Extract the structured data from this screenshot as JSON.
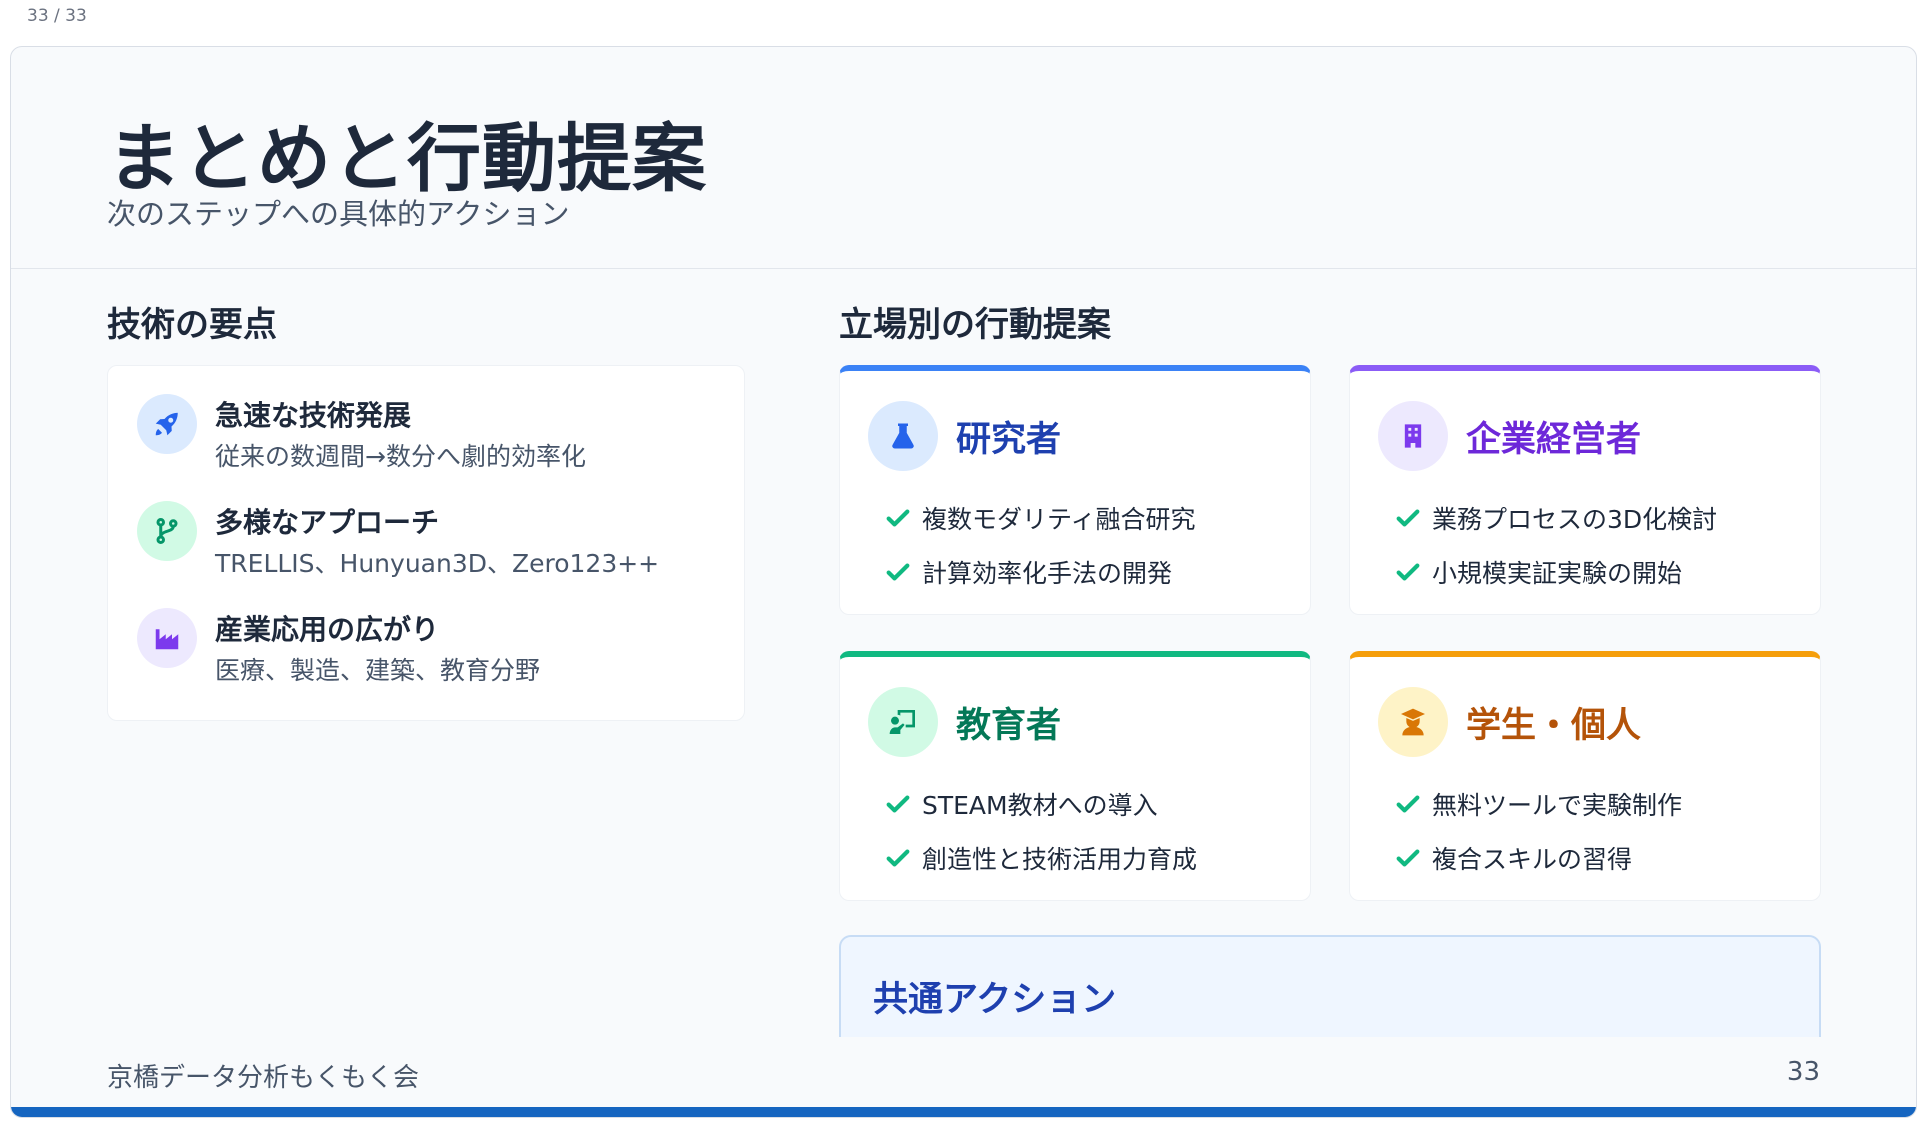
{
  "page_counter": "33 / 33",
  "header": {
    "title": "まとめと行動提案",
    "subtitle": "次のステップへの具体的アクション"
  },
  "tech_points": {
    "heading": "技術の要点",
    "items": [
      {
        "icon": "rocket-icon",
        "title": "急速な技術発展",
        "desc": "従来の数週間→数分へ劇的効率化",
        "color": "#2563eb",
        "bg": "#dbeafe"
      },
      {
        "icon": "code-branch-icon",
        "title": "多様なアプローチ",
        "desc": "TRELLIS、Hunyuan3D、Zero123++",
        "color": "#059669",
        "bg": "#d1fae5"
      },
      {
        "icon": "industry-icon",
        "title": "産業応用の広がり",
        "desc": "医療、製造、建築、教育分野",
        "color": "#7c3aed",
        "bg": "#ede9fe"
      }
    ]
  },
  "actions": {
    "heading": "立場別の行動提案",
    "roles": [
      {
        "icon": "flask-icon",
        "title": "研究者",
        "color": "#1e40af",
        "border": "#3b82f6",
        "bg": "#dbeafe",
        "items": [
          "複数モダリティ融合研究",
          "計算効率化手法の開発"
        ]
      },
      {
        "icon": "building-icon",
        "title": "企業経営者",
        "color": "#6d28d9",
        "border": "#8b5cf6",
        "bg": "#ede9fe",
        "items": [
          "業務プロセスの3D化検討",
          "小規模実証実験の開始"
        ]
      },
      {
        "icon": "chalkboard-teacher-icon",
        "title": "教育者",
        "color": "#047857",
        "border": "#10b981",
        "bg": "#d1fae5",
        "items": [
          "STEAM教材への導入",
          "創造性と技術活用力育成"
        ]
      },
      {
        "icon": "graduate-icon",
        "title": "学生・個人",
        "color": "#b45309",
        "border": "#f59e0b",
        "bg": "#fef3c7",
        "items": [
          "無料ツールで実験制作",
          "複合スキルの習得"
        ]
      }
    ],
    "check_color": "#10b981",
    "common_title": "共通アクション"
  },
  "footer": {
    "left": "京橋データ分析もくもく会",
    "right": "33"
  }
}
